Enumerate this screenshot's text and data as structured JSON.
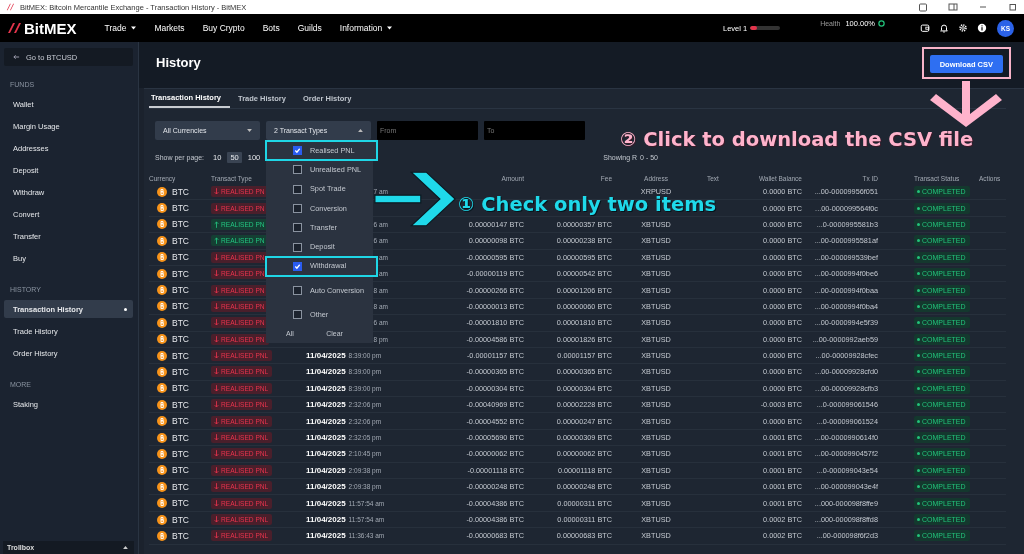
{
  "browser": {
    "title": "BitMEX: Bitcoin Mercantile Exchange - Transaction History - BitMEX"
  },
  "topbar": {
    "logo": "BitMEX",
    "nav": [
      {
        "label": "Trade",
        "dropdown": true
      },
      {
        "label": "Markets",
        "dropdown": false
      },
      {
        "label": "Buy Crypto",
        "dropdown": false
      },
      {
        "label": "Bots",
        "dropdown": false
      },
      {
        "label": "Guilds",
        "dropdown": false
      },
      {
        "label": "Information",
        "dropdown": true
      }
    ],
    "level": {
      "label": "Level 1",
      "level": 0.22
    },
    "health": {
      "label": "Health",
      "value": "100.00%"
    },
    "avatar": "KS"
  },
  "sidebar": {
    "back": "Go to BTCUSD",
    "sections": [
      {
        "title": "FUNDS",
        "items": [
          {
            "label": "Wallet",
            "selected": false
          },
          {
            "label": "Margin Usage",
            "selected": false
          },
          {
            "label": "Addresses",
            "selected": false
          },
          {
            "label": "Deposit",
            "selected": false
          },
          {
            "label": "Withdraw",
            "selected": false
          },
          {
            "label": "Convert",
            "selected": false
          },
          {
            "label": "Transfer",
            "selected": false
          },
          {
            "label": "Buy",
            "selected": false
          }
        ]
      },
      {
        "title": "HISTORY",
        "items": [
          {
            "label": "Transaction History",
            "selected": true
          },
          {
            "label": "Trade History",
            "selected": false
          },
          {
            "label": "Order History",
            "selected": false
          }
        ]
      },
      {
        "title": "MORE",
        "items": [
          {
            "label": "Staking",
            "selected": false
          }
        ]
      }
    ],
    "footer": "Trollbox"
  },
  "page": {
    "title": "History",
    "download": "Download CSV"
  },
  "tabs": [
    {
      "label": "Transaction History",
      "selected": true
    },
    {
      "label": "Trade History",
      "selected": false
    },
    {
      "label": "Order History",
      "selected": false
    }
  ],
  "filters": {
    "currency": "All Currencies",
    "types": "2 Transact Types",
    "from_placeholder": "From",
    "to_placeholder": "To"
  },
  "type_menu": {
    "items": [
      {
        "label": "Realised PNL",
        "checked": true,
        "highlighted": true
      },
      {
        "label": "Unrealised PNL",
        "checked": false,
        "highlighted": false
      },
      {
        "label": "Spot Trade",
        "checked": false,
        "highlighted": false
      },
      {
        "label": "Conversion",
        "checked": false,
        "highlighted": false
      },
      {
        "label": "Transfer",
        "checked": false,
        "highlighted": false
      },
      {
        "label": "Deposit",
        "checked": false,
        "highlighted": false
      },
      {
        "label": "Withdrawal",
        "checked": true,
        "highlighted": true
      },
      {
        "label": "Auto Conversion",
        "checked": false,
        "highlighted": false
      },
      {
        "label": "Other",
        "checked": false,
        "highlighted": false
      }
    ],
    "all": "All",
    "clear": "Clear"
  },
  "per_page": {
    "label": "Show per page:",
    "options": [
      {
        "label": "10",
        "selected": false
      },
      {
        "label": "50",
        "selected": true
      },
      {
        "label": "100",
        "selected": false
      }
    ]
  },
  "showing": [
    "Showing R",
    "0 - 50"
  ],
  "annotations": [
    "① Check only two items",
    "② Click to download the CSV file"
  ],
  "table": {
    "columns": [
      "Currency",
      "Transact Type",
      "Amount",
      "Fee",
      "Address",
      "Text",
      "Wallet Balance",
      "Tx ID",
      "Transact Status",
      "Actions"
    ],
    "rows": [
      {
        "currency": "BTC",
        "type": "REALISED PN",
        "kind": "down",
        "time": "7 am",
        "address": "XRPUSD",
        "wallet": "0.0000 BTC",
        "txid": "...00-00009956f051",
        "status": "COMPLETED"
      },
      {
        "currency": "BTC",
        "type": "REALISED PN",
        "kind": "down",
        "wallet": "0.0000 BTC",
        "txid": "...00-000099564f0c",
        "status": "COMPLETED"
      },
      {
        "currency": "BTC",
        "type": "REALISED PN",
        "kind": "up",
        "time": "6 am",
        "amount": "0.00000147 BTC",
        "fee": "0.00000357 BTC",
        "address": "XBTUSD",
        "wallet": "0.0000 BTC",
        "txid": "...0-0000995581b3",
        "status": "COMPLETED"
      },
      {
        "currency": "BTC",
        "type": "REALISED PN",
        "kind": "up",
        "time": "6 am",
        "amount": "0.00000098 BTC",
        "fee": "0.00000238 BTC",
        "address": "XBTUSD",
        "wallet": "0.0000 BTC",
        "txid": "...00-0000995581af",
        "status": "COMPLETED"
      },
      {
        "currency": "BTC",
        "type": "REALISED PN",
        "kind": "down",
        "time": "am",
        "amount": "-0.00000595 BTC",
        "fee": "0.00000595 BTC",
        "address": "XBTUSD",
        "wallet": "0.0000 BTC",
        "txid": "...00-000099539bef",
        "status": "COMPLETED"
      },
      {
        "currency": "BTC",
        "type": "REALISED PN",
        "kind": "down",
        "time": "am",
        "amount": "-0.00000119 BTC",
        "fee": "0.00000542 BTC",
        "address": "XBTUSD",
        "wallet": "0.0000 BTC",
        "txid": "...00-0000994f0be6",
        "status": "COMPLETED"
      },
      {
        "currency": "BTC",
        "type": "REALISED PN",
        "kind": "down",
        "time": "8 am",
        "amount": "-0.00000266 BTC",
        "fee": "0.00001206 BTC",
        "address": "XBTUSD",
        "wallet": "0.0000 BTC",
        "txid": "...00-0000994f0baa",
        "status": "COMPLETED"
      },
      {
        "currency": "BTC",
        "type": "REALISED PN",
        "kind": "down",
        "time": "8 am",
        "amount": "-0.00000013 BTC",
        "fee": "0.00000060 BTC",
        "address": "XBTUSD",
        "wallet": "0.0000 BTC",
        "txid": "...00-0000994f0ba4",
        "status": "COMPLETED"
      },
      {
        "currency": "BTC",
        "type": "REALISED PN",
        "kind": "down",
        "time": "6 am",
        "amount": "-0.00001810 BTC",
        "fee": "0.00001810 BTC",
        "address": "XBTUSD",
        "wallet": "0.0000 BTC",
        "txid": "...00-0000994e5f39",
        "status": "COMPLETED"
      },
      {
        "currency": "BTC",
        "type": "REALISED PN",
        "kind": "down",
        "time": "8 pm",
        "amount": "-0.00004586 BTC",
        "fee": "0.00001826 BTC",
        "address": "XBTUSD",
        "wallet": "0.0000 BTC",
        "txid": "...00-0000992aeb59",
        "status": "COMPLETED"
      },
      {
        "currency": "BTC",
        "type": "REALISED PNL",
        "kind": "down",
        "date": "11/04/2025",
        "time": "8:39:00 pm",
        "amount": "-0.00001157 BTC",
        "fee": "0.00001157 BTC",
        "address": "XBTUSD",
        "wallet": "0.0000 BTC",
        "txid": "...00-00009928cfec",
        "status": "COMPLETED"
      },
      {
        "currency": "BTC",
        "type": "REALISED PNL",
        "kind": "down",
        "date": "11/04/2025",
        "time": "8:39:00 pm",
        "amount": "-0.00000365 BTC",
        "fee": "0.00000365 BTC",
        "address": "XBTUSD",
        "wallet": "0.0000 BTC",
        "txid": "...00-00009928cfd0",
        "status": "COMPLETED"
      },
      {
        "currency": "BTC",
        "type": "REALISED PNL",
        "kind": "down",
        "date": "11/04/2025",
        "time": "8:39:00 pm",
        "amount": "-0.00000304 BTC",
        "fee": "0.00000304 BTC",
        "address": "XBTUSD",
        "wallet": "0.0000 BTC",
        "txid": "...00-00009928cfb3",
        "status": "COMPLETED"
      },
      {
        "currency": "BTC",
        "type": "REALISED PNL",
        "kind": "down",
        "date": "11/04/2025",
        "time": "2:32:06 pm",
        "amount": "-0.00040969 BTC",
        "fee": "0.00002228 BTC",
        "address": "XBTUSD",
        "wallet": "-0.0003 BTC",
        "txid": "...0-000099061546",
        "status": "COMPLETED"
      },
      {
        "currency": "BTC",
        "type": "REALISED PNL",
        "kind": "down",
        "date": "11/04/2025",
        "time": "2:32:06 pm",
        "amount": "-0.00004552 BTC",
        "fee": "0.00000247 BTC",
        "address": "XBTUSD",
        "wallet": "0.0000 BTC",
        "txid": "...0-000099061524",
        "status": "COMPLETED"
      },
      {
        "currency": "BTC",
        "type": "REALISED PNL",
        "kind": "down",
        "date": "11/04/2025",
        "time": "2:32:05 pm",
        "amount": "-0.00005690 BTC",
        "fee": "0.00000309 BTC",
        "address": "XBTUSD",
        "wallet": "0.0001 BTC",
        "txid": "...00-0000990614f0",
        "status": "COMPLETED"
      },
      {
        "currency": "BTC",
        "type": "REALISED PNL",
        "kind": "down",
        "date": "11/04/2025",
        "time": "2:10:45 pm",
        "amount": "-0.00000062 BTC",
        "fee": "0.00000062 BTC",
        "address": "XBTUSD",
        "wallet": "0.0001 BTC",
        "txid": "...00-0000990457f2",
        "status": "COMPLETED"
      },
      {
        "currency": "BTC",
        "type": "REALISED PNL",
        "kind": "down",
        "date": "11/04/2025",
        "time": "2:09:38 pm",
        "amount": "-0.00001118 BTC",
        "fee": "0.00001118 BTC",
        "address": "XBTUSD",
        "wallet": "0.0001 BTC",
        "txid": "...0-000099043e54",
        "status": "COMPLETED"
      },
      {
        "currency": "BTC",
        "type": "REALISED PNL",
        "kind": "down",
        "date": "11/04/2025",
        "time": "2:09:38 pm",
        "amount": "-0.00000248 BTC",
        "fee": "0.00000248 BTC",
        "address": "XBTUSD",
        "wallet": "0.0001 BTC",
        "txid": "...00-000099043e4f",
        "status": "COMPLETED"
      },
      {
        "currency": "BTC",
        "type": "REALISED PNL",
        "kind": "down",
        "date": "11/04/2025",
        "time": "11:57:54 am",
        "amount": "-0.00004386 BTC",
        "fee": "0.00000311 BTC",
        "address": "XBTUSD",
        "wallet": "0.0001 BTC",
        "txid": "...000-000098f8ffe9",
        "status": "COMPLETED"
      },
      {
        "currency": "BTC",
        "type": "REALISED PNL",
        "kind": "down",
        "date": "11/04/2025",
        "time": "11:57:54 am",
        "amount": "-0.00004386 BTC",
        "fee": "0.00000311 BTC",
        "address": "XBTUSD",
        "wallet": "0.0002 BTC",
        "txid": "...000-000098f8ffd8",
        "status": "COMPLETED"
      },
      {
        "currency": "BTC",
        "type": "REALISED PNL",
        "kind": "down",
        "date": "11/04/2025",
        "time": "11:36:43 am",
        "amount": "-0.00000683 BTC",
        "fee": "0.00000683 BTC",
        "address": "XBTUSD",
        "wallet": "0.0002 BTC",
        "txid": "...00-000098f6f2d3",
        "status": "COMPLETED"
      }
    ]
  }
}
